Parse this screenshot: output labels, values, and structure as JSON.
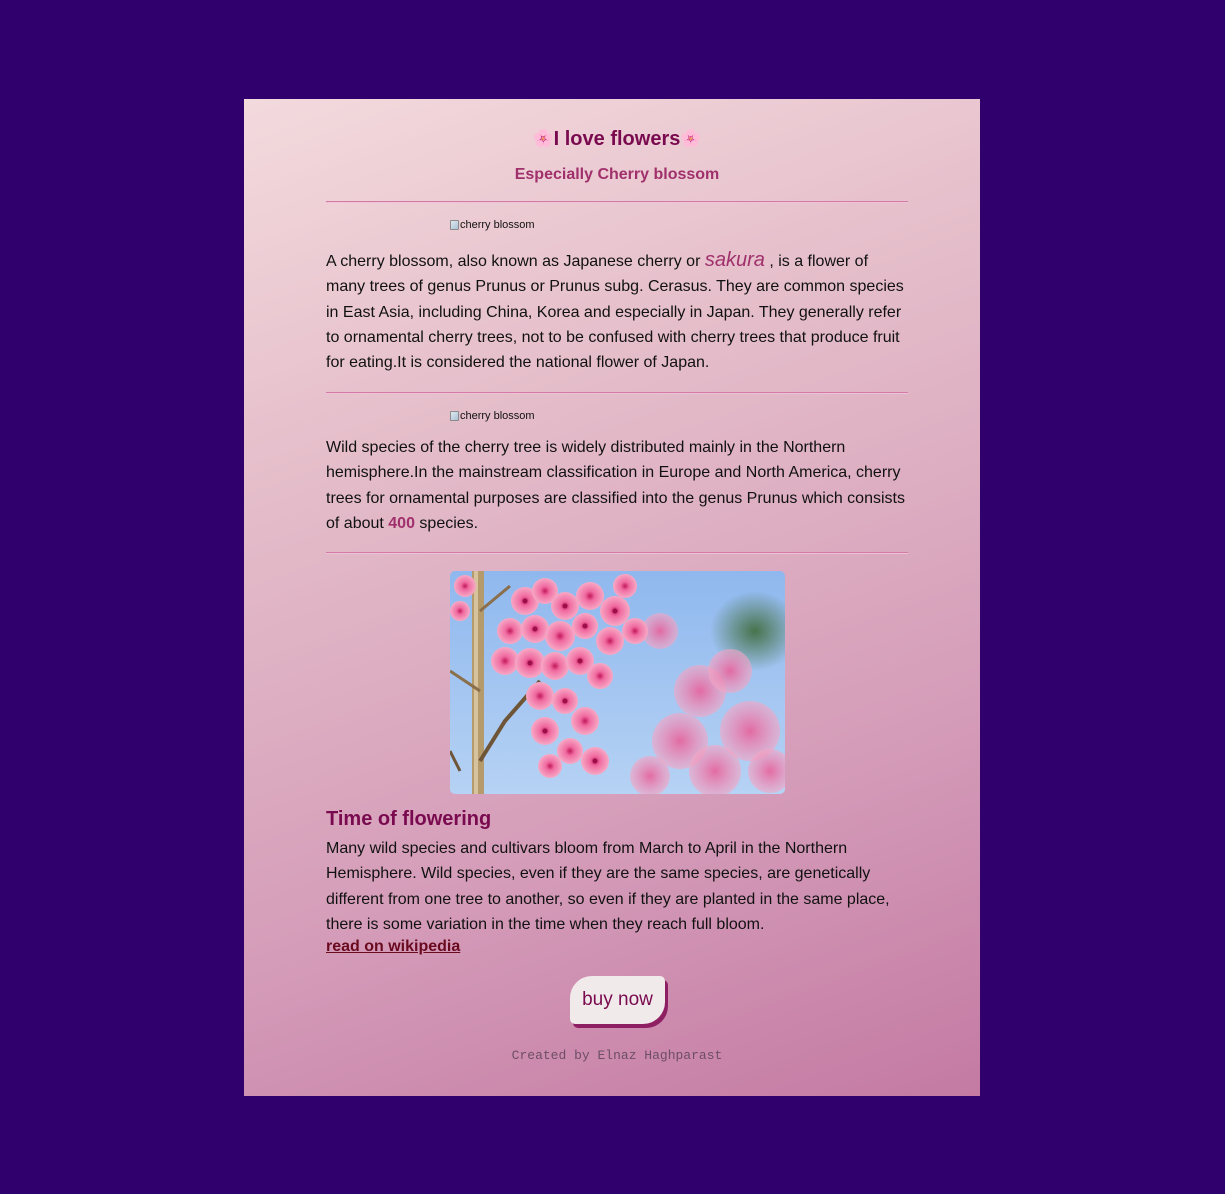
{
  "header": {
    "flower_left": "🌸",
    "title": "I love flowers",
    "flower_right": "🌸",
    "subtitle": "Especially Cherry blossom"
  },
  "section1": {
    "image_alt": "cherry blossom",
    "text_before": "A cherry blossom, also known as Japanese cherry or ",
    "highlight": "sakura",
    "text_after": " , is a flower of many trees of genus Prunus or Prunus subg. Cerasus. They are common species in East Asia, including China, Korea and especially in Japan. They generally refer to ornamental cherry trees, not to be confused with cherry trees that produce fruit for eating.It is considered the national flower of Japan."
  },
  "section2": {
    "image_alt": "cherry blossom",
    "text_before": "Wild species of the cherry tree is widely distributed mainly in the Northern hemisphere.In the mainstream classification in Europe and North America, cherry trees for ornamental purposes are classified into the genus Prunus which consists of about ",
    "count": "400",
    "text_after": " species."
  },
  "section3": {
    "heading": "Time of flowering",
    "text": "Many wild species and cultivars bloom from March to April in the Northern Hemisphere. Wild species, even if they are the same species, are genetically different from one tree to another, so even if they are planted in the same place, there is some variation in the time when they reach full bloom.",
    "link_label": "read on wikipedia"
  },
  "buy_button": {
    "label": "buy now"
  },
  "footer": {
    "credit": "Created by Elnaz Haghparast"
  },
  "colors": {
    "background": "#30006c",
    "accent": "#7a0a4f",
    "accent_light": "#a0306b",
    "link": "#6a0a1f"
  }
}
